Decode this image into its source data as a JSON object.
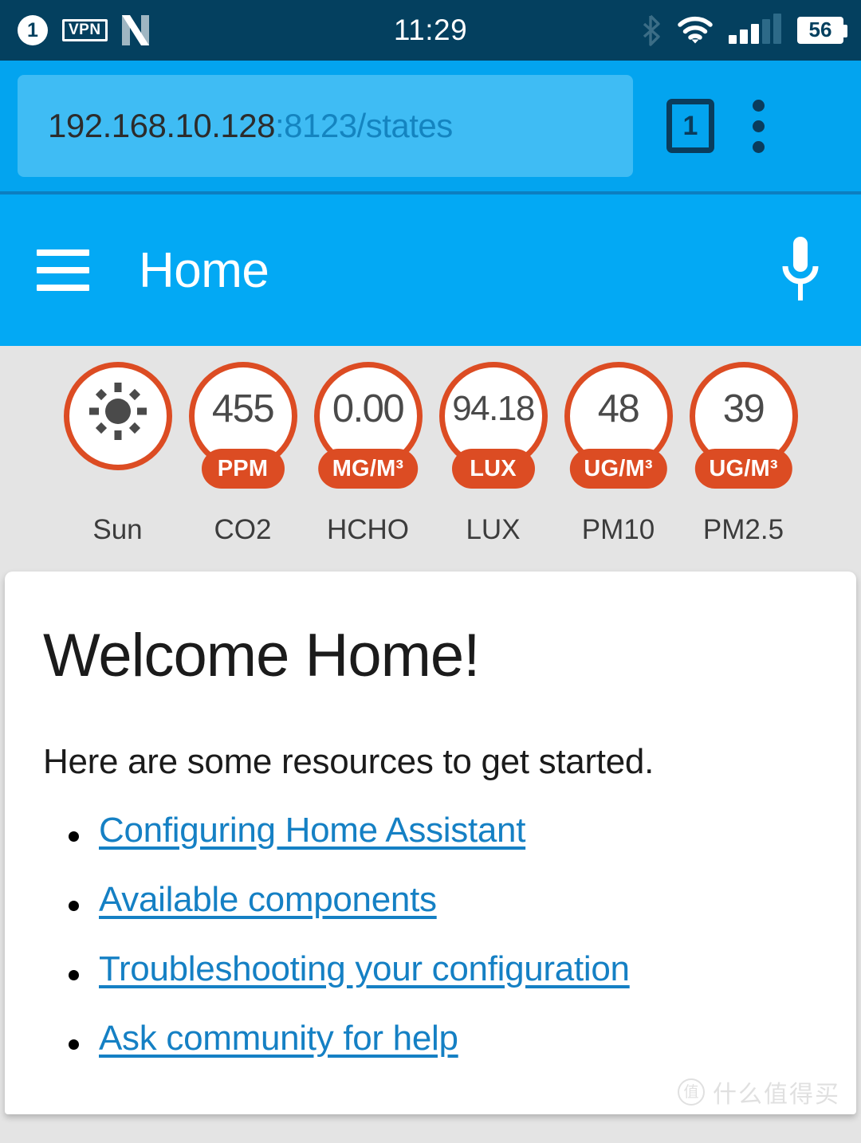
{
  "status_bar": {
    "notification_count": "1",
    "vpn_label": "VPN",
    "netflix_icon": "netflix-icon",
    "clock": "11:29",
    "bluetooth_icon": "bluetooth-icon",
    "wifi_icon": "wifi-icon",
    "signal_icon": "cellular-signal-icon",
    "battery_level": "56",
    "background_color": "#04405F"
  },
  "browser": {
    "url_host": "192.168.10.128",
    "url_rest": ":8123/states",
    "tab_count": "1",
    "menu_icon": "kebab-menu-icon",
    "accent_color": "#03A4EF"
  },
  "app_bar": {
    "menu_icon": "hamburger-menu-icon",
    "title": "Home",
    "voice_icon": "microphone-icon",
    "accent_color": "#03A9F4"
  },
  "badges": {
    "accent_color": "#DC4C23",
    "items": [
      {
        "icon": "sun-icon",
        "value": "",
        "unit": "",
        "label": "Sun"
      },
      {
        "icon": "",
        "value": "455",
        "unit": "PPM",
        "label": "CO2"
      },
      {
        "icon": "",
        "value": "0.00",
        "unit": "MG/M³",
        "label": "HCHO"
      },
      {
        "icon": "",
        "value": "94.18",
        "unit": "LUX",
        "label": "LUX"
      },
      {
        "icon": "",
        "value": "48",
        "unit": "UG/M³",
        "label": "PM10"
      },
      {
        "icon": "",
        "value": "39",
        "unit": "UG/M³",
        "label": "PM2.5"
      }
    ]
  },
  "content": {
    "heading": "Welcome Home!",
    "intro": "Here are some resources to get started.",
    "links": [
      "Configuring Home Assistant",
      "Available components",
      "Troubleshooting your configuration",
      "Ask community for help"
    ],
    "link_color": "#1580C4"
  },
  "watermark": {
    "logo_glyph": "值",
    "text": "什么值得买"
  }
}
